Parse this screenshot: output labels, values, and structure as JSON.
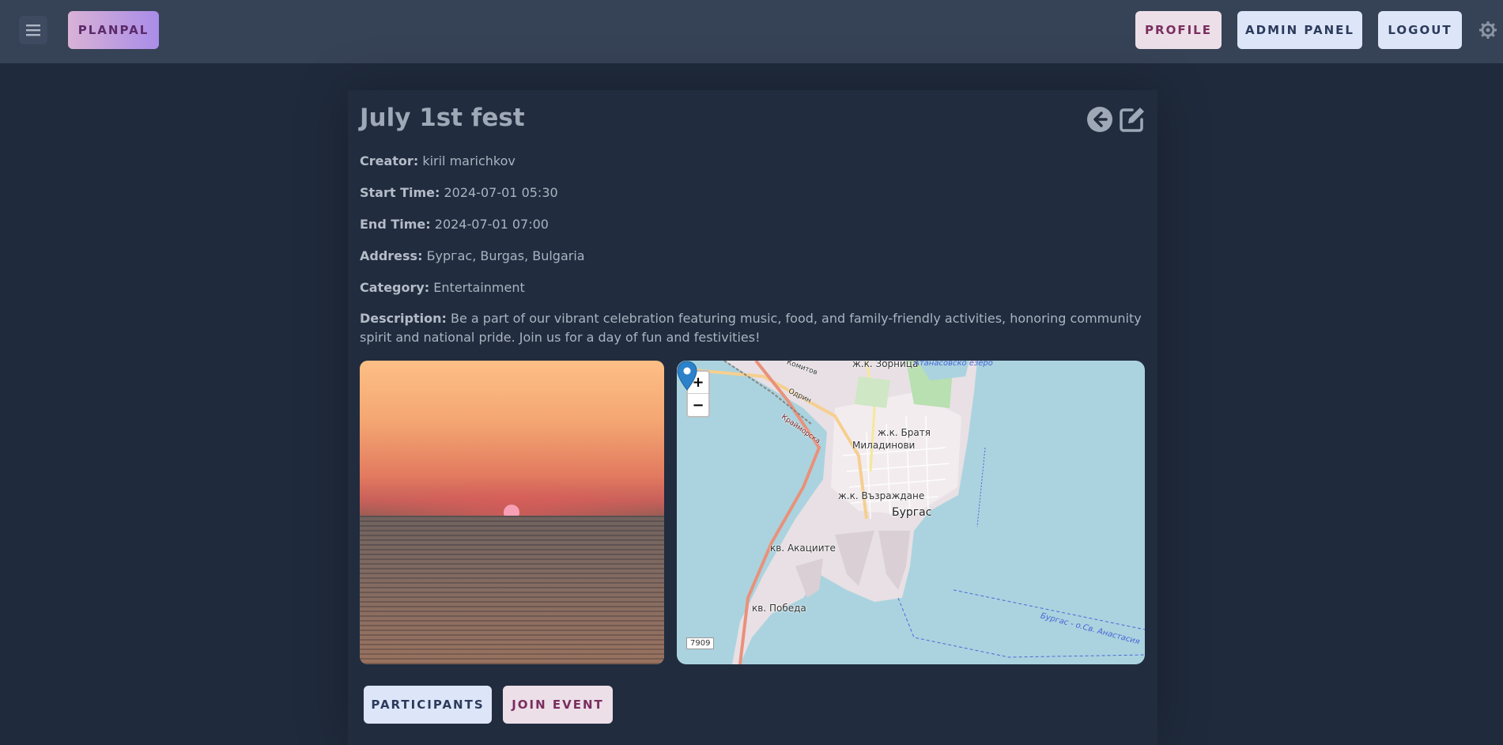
{
  "header": {
    "brand": "PLANPAL",
    "profile_label": "PROFILE",
    "admin_label": "ADMIN PANEL",
    "logout_label": "LOGOUT"
  },
  "event": {
    "title": "July 1st fest",
    "fields": [
      {
        "label": "Creator:",
        "value": "kiril marichkov"
      },
      {
        "label": "Start Time:",
        "value": "2024-07-01 05:30"
      },
      {
        "label": "End Time:",
        "value": "2024-07-01 07:00"
      },
      {
        "label": "Address:",
        "value": "Бургас, Burgas, Bulgaria"
      },
      {
        "label": "Category:",
        "value": "Entertainment"
      },
      {
        "label": "Description:",
        "value": "Be a part of our vibrant celebration featuring music, food, and family-friendly activities, honoring community spirit and national pride. Join us for a day of fun and festivities!"
      }
    ]
  },
  "map": {
    "zoom_in": "+",
    "zoom_out": "−",
    "scale": "7909",
    "labels": {
      "zornitsa": "ж.к. Зорница",
      "lake": "Атанасовско езеро",
      "bratya": "ж.к. Братя",
      "miladinovi": "Миладинови",
      "vazrazhdane": "ж.к. Възраждане",
      "city": "Бургас",
      "akatsiite": "кв. Акациите",
      "pobeda": "кв. Победа",
      "ferry": "Бургас - о.Св. Анастасия",
      "odrin": "Одрин",
      "kraymorska": "Крайморска",
      "komitov": "Комитов"
    }
  },
  "actions": {
    "participants_label": "PARTICIPANTS",
    "join_label": "JOIN EVENT"
  },
  "icons": {
    "menu": "hamburger-icon",
    "theme": "gear-icon",
    "back": "arrow-left-circle-icon",
    "edit": "edit-icon",
    "pin": "map-pin-icon"
  },
  "colors": {
    "background": "#1f2a3c",
    "topbar": "#364256",
    "accent_pink": "#ecdfe8",
    "accent_blue": "#dde6f8"
  }
}
